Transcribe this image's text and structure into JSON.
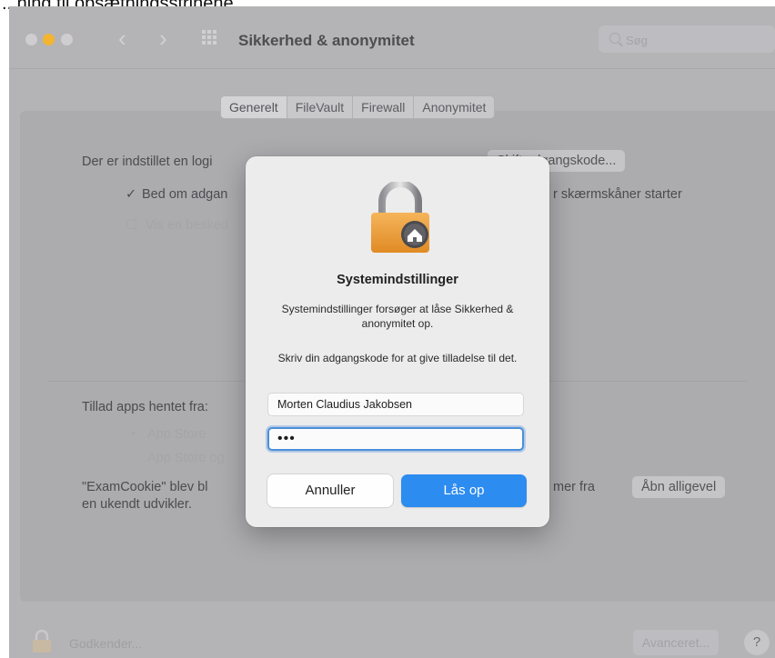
{
  "caption": "...ning til opsætningsstrinene",
  "window": {
    "title": "Sikkerhed & anonymitet",
    "search_placeholder": "Søg"
  },
  "tabs": [
    "Generelt",
    "FileVault",
    "Firewall",
    "Anonymitet"
  ],
  "general": {
    "login_text": "Der er indstillet en logi",
    "change_password_button": "Skift adgangskode...",
    "require_password_label": "Bed om adgan",
    "require_password_suffix": "r skærmskåner starter",
    "show_message_label": "Vis en besked",
    "allow_apps_label": "Tillad apps hentet fra:",
    "app_store_option": "App Store",
    "app_store_identified_option": "App Store og",
    "blocked_text_line1": "\"ExamCookie\" blev bl",
    "blocked_text_line1_suffix": "mer fra",
    "blocked_text_line2": "en ukendt udvikler.",
    "open_anyway_button": "Åbn alligevel"
  },
  "footer": {
    "lock_label": "Godkender...",
    "advanced_button": "Avanceret...",
    "help_button": "?"
  },
  "dialog": {
    "title": "Systemindstillinger",
    "message": "Systemindstillinger forsøger at låse Sikkerhed & anonymitet op.",
    "prompt": "Skriv din adgangskode for at give tilladelse til det.",
    "username_value": "Morten Claudius Jakobsen",
    "password_display": "•••",
    "cancel_label": "Annuller",
    "unlock_label": "Lås op"
  },
  "colors": {
    "accent": "#2d8cf0",
    "traffic_yellow": "#f3b531",
    "focus_ring": "#4c8ed9"
  }
}
